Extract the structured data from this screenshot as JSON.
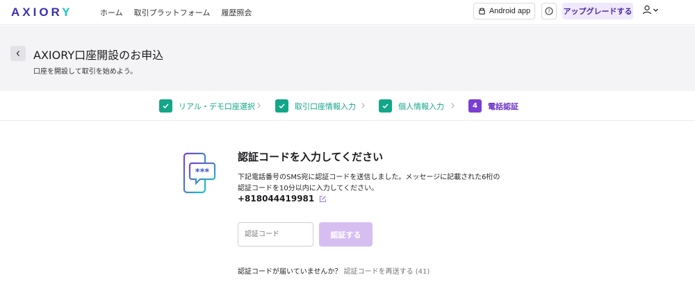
{
  "nav": {
    "logo": {
      "left": "AXIOR",
      "right": "Y"
    },
    "links": [
      "ホーム",
      "取引プラットフォーム",
      "履歴照会"
    ],
    "android_label": "Android app",
    "upgrade_label": "アップグレードする"
  },
  "header": {
    "title": "AXIORY口座開設のお申込",
    "subtitle": "口座を開設して取引を始めよう。"
  },
  "steps": [
    {
      "label": "リアル・デモ口座選択",
      "state": "done"
    },
    {
      "label": "取引口座情報入力",
      "state": "done"
    },
    {
      "label": "個人情報入力",
      "state": "done"
    },
    {
      "label": "電話認証",
      "state": "active",
      "number": "4"
    }
  ],
  "verify": {
    "heading": "認証コードを入力してください",
    "description": "下記電話番号のSMS宛に認証コードを送信しました。メッセージに記載された6桁の認証コードを10分以内に入力してください。",
    "phone": "+818044419981",
    "input_placeholder": "認証コード",
    "button_label": "認証する",
    "resend_prompt": "認証コードが届いていませんか？",
    "resend_link": "認証コードを再送する",
    "resend_countdown": "(41)",
    "bubble_text": "***"
  },
  "colors": {
    "brand": "#3a2fb6",
    "accent_cyan": "#17c3c9",
    "step_done": "#14a689",
    "step_active": "#7a3fd1",
    "button_disabled": "#d6bff0"
  }
}
